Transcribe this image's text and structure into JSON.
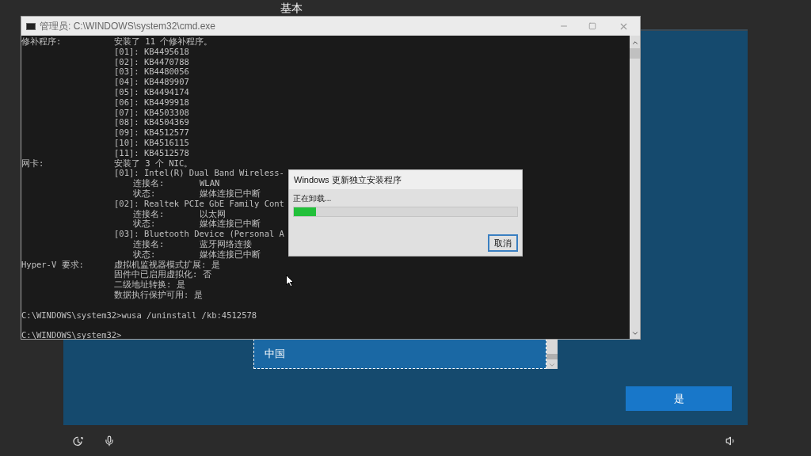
{
  "setup": {
    "heading": "基本",
    "region_list": [
      {
        "label": "中国",
        "selected": true
      }
    ],
    "yes_button": "是"
  },
  "cmd_window": {
    "title": "管理员: C:\\WINDOWS\\system32\\cmd.exe",
    "lines": [
      {
        "kind": "main",
        "label": "修补程序:",
        "value": "安装了 11 个修补程序。"
      },
      {
        "kind": "item",
        "value": "[01]: KB4495618"
      },
      {
        "kind": "item",
        "value": "[02]: KB4470788"
      },
      {
        "kind": "item",
        "value": "[03]: KB4480056"
      },
      {
        "kind": "item",
        "value": "[04]: KB4489907"
      },
      {
        "kind": "item",
        "value": "[05]: KB4494174"
      },
      {
        "kind": "item",
        "value": "[06]: KB4499918"
      },
      {
        "kind": "item",
        "value": "[07]: KB4503308"
      },
      {
        "kind": "item",
        "value": "[08]: KB4504369"
      },
      {
        "kind": "item",
        "value": "[09]: KB4512577"
      },
      {
        "kind": "item",
        "value": "[10]: KB4516115"
      },
      {
        "kind": "item",
        "value": "[11]: KB4512578"
      },
      {
        "kind": "main",
        "label": "网卡:",
        "value": "安装了 3 个 NIC。"
      },
      {
        "kind": "item",
        "value": "[01]: Intel(R) Dual Band Wireless-"
      },
      {
        "kind": "detail",
        "label": "连接名:",
        "value": "WLAN"
      },
      {
        "kind": "detail",
        "label": "状态:",
        "value": "媒体连接已中断"
      },
      {
        "kind": "item",
        "value": "[02]: Realtek PCIe GbE Family Cont"
      },
      {
        "kind": "detail",
        "label": "连接名:",
        "value": "以太网"
      },
      {
        "kind": "detail",
        "label": "状态:",
        "value": "媒体连接已中断"
      },
      {
        "kind": "item",
        "value": "[03]: Bluetooth Device (Personal A"
      },
      {
        "kind": "detail",
        "label": "连接名:",
        "value": "蓝牙网络连接"
      },
      {
        "kind": "detail",
        "label": "状态:",
        "value": "媒体连接已中断"
      },
      {
        "kind": "main",
        "label": "Hyper-V 要求:",
        "value": "虚拟机监视器模式扩展: 是"
      },
      {
        "kind": "item",
        "value": "固件中已启用虚拟化: 否"
      },
      {
        "kind": "item",
        "value": "二级地址转换: 是"
      },
      {
        "kind": "item",
        "value": "数据执行保护可用: 是"
      },
      {
        "kind": "blank"
      },
      {
        "kind": "prompt",
        "value": "C:\\WINDOWS\\system32>wusa /uninstall /kb:4512578"
      },
      {
        "kind": "blank"
      },
      {
        "kind": "prompt",
        "value": "C:\\WINDOWS\\system32>"
      }
    ]
  },
  "dialog": {
    "title": "Windows 更新独立安装程序",
    "status": "正在卸载...",
    "progress": {
      "level": 0.1
    },
    "cancel_button": "取消"
  }
}
